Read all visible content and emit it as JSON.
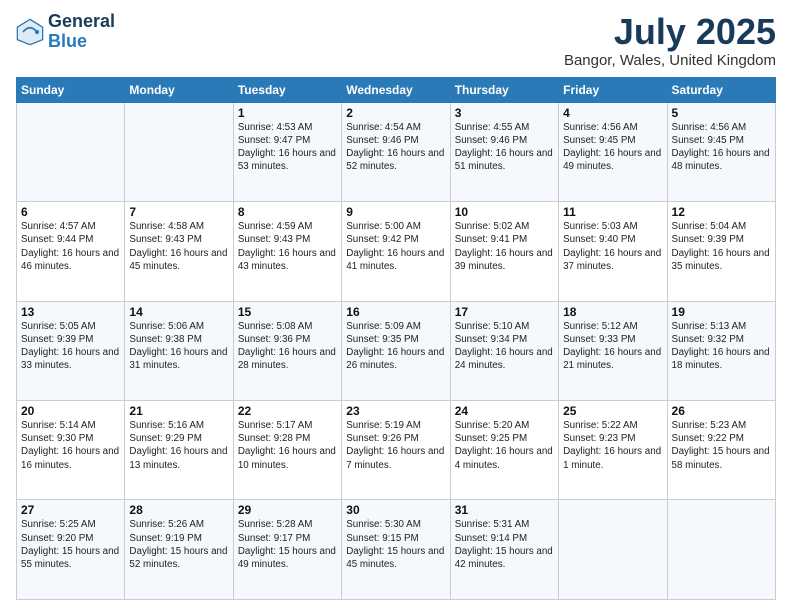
{
  "header": {
    "logo_line1": "General",
    "logo_line2": "Blue",
    "month": "July 2025",
    "location": "Bangor, Wales, United Kingdom"
  },
  "weekdays": [
    "Sunday",
    "Monday",
    "Tuesday",
    "Wednesday",
    "Thursday",
    "Friday",
    "Saturday"
  ],
  "rows": [
    [
      {
        "day": "",
        "sunrise": "",
        "sunset": "",
        "daylight": ""
      },
      {
        "day": "",
        "sunrise": "",
        "sunset": "",
        "daylight": ""
      },
      {
        "day": "1",
        "sunrise": "Sunrise: 4:53 AM",
        "sunset": "Sunset: 9:47 PM",
        "daylight": "Daylight: 16 hours and 53 minutes."
      },
      {
        "day": "2",
        "sunrise": "Sunrise: 4:54 AM",
        "sunset": "Sunset: 9:46 PM",
        "daylight": "Daylight: 16 hours and 52 minutes."
      },
      {
        "day": "3",
        "sunrise": "Sunrise: 4:55 AM",
        "sunset": "Sunset: 9:46 PM",
        "daylight": "Daylight: 16 hours and 51 minutes."
      },
      {
        "day": "4",
        "sunrise": "Sunrise: 4:56 AM",
        "sunset": "Sunset: 9:45 PM",
        "daylight": "Daylight: 16 hours and 49 minutes."
      },
      {
        "day": "5",
        "sunrise": "Sunrise: 4:56 AM",
        "sunset": "Sunset: 9:45 PM",
        "daylight": "Daylight: 16 hours and 48 minutes."
      }
    ],
    [
      {
        "day": "6",
        "sunrise": "Sunrise: 4:57 AM",
        "sunset": "Sunset: 9:44 PM",
        "daylight": "Daylight: 16 hours and 46 minutes."
      },
      {
        "day": "7",
        "sunrise": "Sunrise: 4:58 AM",
        "sunset": "Sunset: 9:43 PM",
        "daylight": "Daylight: 16 hours and 45 minutes."
      },
      {
        "day": "8",
        "sunrise": "Sunrise: 4:59 AM",
        "sunset": "Sunset: 9:43 PM",
        "daylight": "Daylight: 16 hours and 43 minutes."
      },
      {
        "day": "9",
        "sunrise": "Sunrise: 5:00 AM",
        "sunset": "Sunset: 9:42 PM",
        "daylight": "Daylight: 16 hours and 41 minutes."
      },
      {
        "day": "10",
        "sunrise": "Sunrise: 5:02 AM",
        "sunset": "Sunset: 9:41 PM",
        "daylight": "Daylight: 16 hours and 39 minutes."
      },
      {
        "day": "11",
        "sunrise": "Sunrise: 5:03 AM",
        "sunset": "Sunset: 9:40 PM",
        "daylight": "Daylight: 16 hours and 37 minutes."
      },
      {
        "day": "12",
        "sunrise": "Sunrise: 5:04 AM",
        "sunset": "Sunset: 9:39 PM",
        "daylight": "Daylight: 16 hours and 35 minutes."
      }
    ],
    [
      {
        "day": "13",
        "sunrise": "Sunrise: 5:05 AM",
        "sunset": "Sunset: 9:39 PM",
        "daylight": "Daylight: 16 hours and 33 minutes."
      },
      {
        "day": "14",
        "sunrise": "Sunrise: 5:06 AM",
        "sunset": "Sunset: 9:38 PM",
        "daylight": "Daylight: 16 hours and 31 minutes."
      },
      {
        "day": "15",
        "sunrise": "Sunrise: 5:08 AM",
        "sunset": "Sunset: 9:36 PM",
        "daylight": "Daylight: 16 hours and 28 minutes."
      },
      {
        "day": "16",
        "sunrise": "Sunrise: 5:09 AM",
        "sunset": "Sunset: 9:35 PM",
        "daylight": "Daylight: 16 hours and 26 minutes."
      },
      {
        "day": "17",
        "sunrise": "Sunrise: 5:10 AM",
        "sunset": "Sunset: 9:34 PM",
        "daylight": "Daylight: 16 hours and 24 minutes."
      },
      {
        "day": "18",
        "sunrise": "Sunrise: 5:12 AM",
        "sunset": "Sunset: 9:33 PM",
        "daylight": "Daylight: 16 hours and 21 minutes."
      },
      {
        "day": "19",
        "sunrise": "Sunrise: 5:13 AM",
        "sunset": "Sunset: 9:32 PM",
        "daylight": "Daylight: 16 hours and 18 minutes."
      }
    ],
    [
      {
        "day": "20",
        "sunrise": "Sunrise: 5:14 AM",
        "sunset": "Sunset: 9:30 PM",
        "daylight": "Daylight: 16 hours and 16 minutes."
      },
      {
        "day": "21",
        "sunrise": "Sunrise: 5:16 AM",
        "sunset": "Sunset: 9:29 PM",
        "daylight": "Daylight: 16 hours and 13 minutes."
      },
      {
        "day": "22",
        "sunrise": "Sunrise: 5:17 AM",
        "sunset": "Sunset: 9:28 PM",
        "daylight": "Daylight: 16 hours and 10 minutes."
      },
      {
        "day": "23",
        "sunrise": "Sunrise: 5:19 AM",
        "sunset": "Sunset: 9:26 PM",
        "daylight": "Daylight: 16 hours and 7 minutes."
      },
      {
        "day": "24",
        "sunrise": "Sunrise: 5:20 AM",
        "sunset": "Sunset: 9:25 PM",
        "daylight": "Daylight: 16 hours and 4 minutes."
      },
      {
        "day": "25",
        "sunrise": "Sunrise: 5:22 AM",
        "sunset": "Sunset: 9:23 PM",
        "daylight": "Daylight: 16 hours and 1 minute."
      },
      {
        "day": "26",
        "sunrise": "Sunrise: 5:23 AM",
        "sunset": "Sunset: 9:22 PM",
        "daylight": "Daylight: 15 hours and 58 minutes."
      }
    ],
    [
      {
        "day": "27",
        "sunrise": "Sunrise: 5:25 AM",
        "sunset": "Sunset: 9:20 PM",
        "daylight": "Daylight: 15 hours and 55 minutes."
      },
      {
        "day": "28",
        "sunrise": "Sunrise: 5:26 AM",
        "sunset": "Sunset: 9:19 PM",
        "daylight": "Daylight: 15 hours and 52 minutes."
      },
      {
        "day": "29",
        "sunrise": "Sunrise: 5:28 AM",
        "sunset": "Sunset: 9:17 PM",
        "daylight": "Daylight: 15 hours and 49 minutes."
      },
      {
        "day": "30",
        "sunrise": "Sunrise: 5:30 AM",
        "sunset": "Sunset: 9:15 PM",
        "daylight": "Daylight: 15 hours and 45 minutes."
      },
      {
        "day": "31",
        "sunrise": "Sunrise: 5:31 AM",
        "sunset": "Sunset: 9:14 PM",
        "daylight": "Daylight: 15 hours and 42 minutes."
      },
      {
        "day": "",
        "sunrise": "",
        "sunset": "",
        "daylight": ""
      },
      {
        "day": "",
        "sunrise": "",
        "sunset": "",
        "daylight": ""
      }
    ]
  ]
}
